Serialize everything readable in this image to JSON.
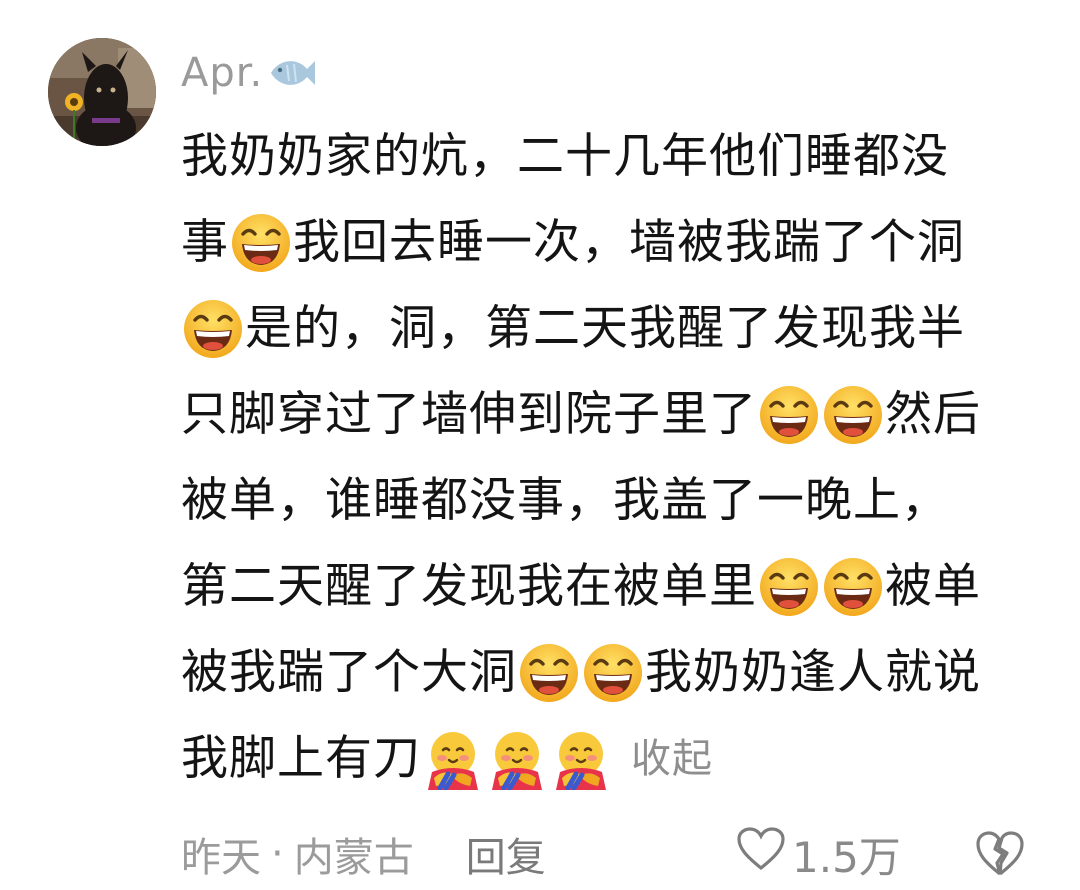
{
  "comment": {
    "username": "Apr.",
    "username_icon": "fish-icon",
    "lines": [
      [
        {
          "t": "我奶奶家的炕，二十几年他们睡都没"
        }
      ],
      [
        {
          "t": "事"
        },
        {
          "e": "grin"
        },
        {
          "t": "我回去睡一次，墙被我踹了个洞"
        }
      ],
      [
        {
          "e": "grin"
        },
        {
          "t": "是的，洞，第二天我醒了发现我半"
        }
      ],
      [
        {
          "t": "只脚穿过了墙伸到院子里了"
        },
        {
          "e": "grin"
        },
        {
          "e": "grin"
        },
        {
          "t": "然后"
        }
      ],
      [
        {
          "t": "被单，谁睡都没事，我盖了一晚上，"
        }
      ],
      [
        {
          "t": "第二天醒了发现我在被单里"
        },
        {
          "e": "grin"
        },
        {
          "e": "grin"
        },
        {
          "t": "被单"
        }
      ],
      [
        {
          "t": "被我踹了个大洞"
        },
        {
          "e": "grin"
        },
        {
          "e": "grin"
        },
        {
          "t": "我奶奶逢人就说"
        }
      ],
      [
        {
          "t": "我脚上有刀"
        },
        {
          "e": "hug"
        },
        {
          "e": "hug"
        },
        {
          "e": "hug"
        },
        {
          "c": "收起"
        }
      ]
    ],
    "meta": {
      "time": "昨天",
      "separator": "·",
      "location": "内蒙古",
      "reply_label": "回复",
      "like_count": "1.5万",
      "like_icon": "heart-outline-icon",
      "dislike_icon": "broken-heart-icon"
    },
    "avatar_icon": "dog-avatar"
  },
  "colors": {
    "text": "#141414",
    "secondary": "#9b9b9b",
    "emoji_yellow": "#f8c236",
    "emoji_orange": "#f09a1a"
  }
}
